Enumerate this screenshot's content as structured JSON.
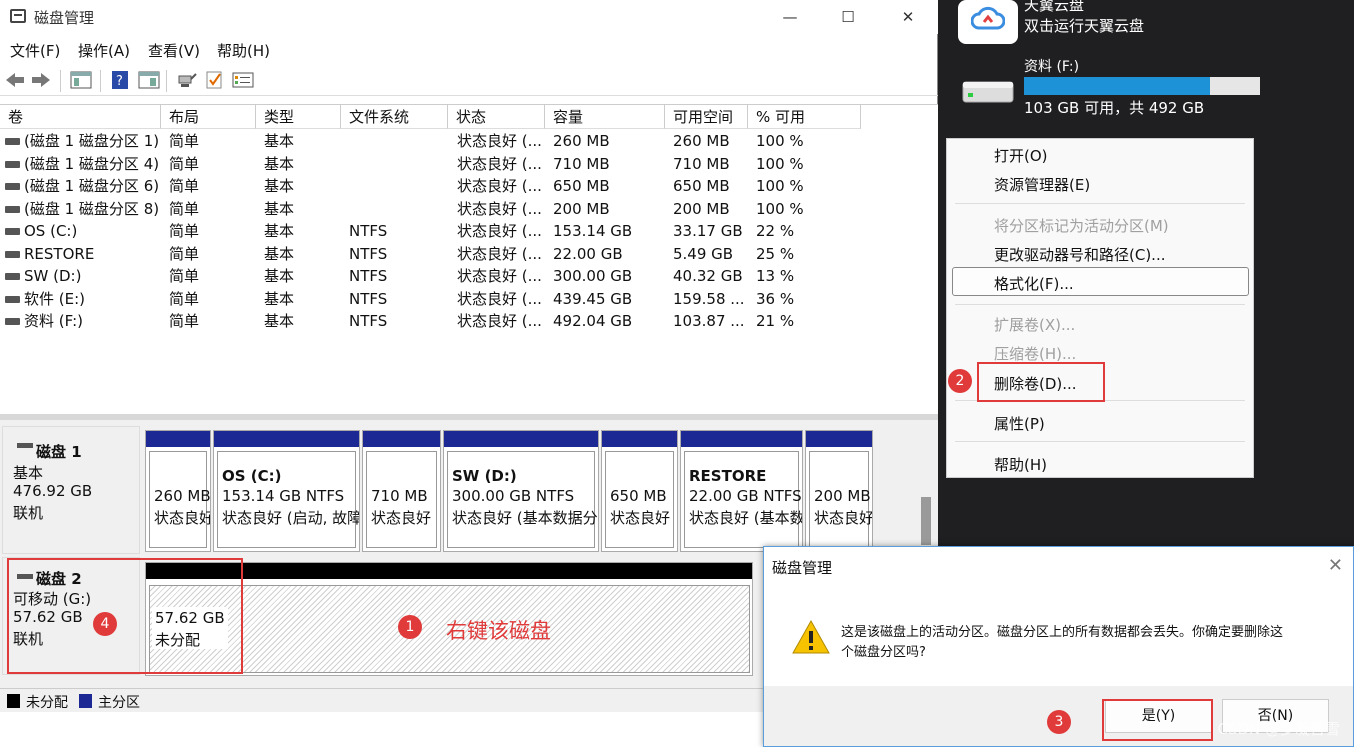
{
  "window": {
    "title": "磁盘管理",
    "controls": {
      "minimize": "—",
      "maximize": "☐",
      "close": "✕"
    }
  },
  "menubar": [
    {
      "label": "文件(F)"
    },
    {
      "label": "操作(A)"
    },
    {
      "label": "查看(V)"
    },
    {
      "label": "帮助(H)"
    }
  ],
  "table": {
    "headers": [
      "卷",
      "布局",
      "类型",
      "文件系统",
      "状态",
      "容量",
      "可用空间",
      "% 可用"
    ],
    "rows": [
      [
        "(磁盘 1 磁盘分区 1)",
        "简单",
        "基本",
        "",
        "状态良好 (...",
        "260 MB",
        "260 MB",
        "100 %"
      ],
      [
        "(磁盘 1 磁盘分区 4)",
        "简单",
        "基本",
        "",
        "状态良好 (...",
        "710 MB",
        "710 MB",
        "100 %"
      ],
      [
        "(磁盘 1 磁盘分区 6)",
        "简单",
        "基本",
        "",
        "状态良好 (...",
        "650 MB",
        "650 MB",
        "100 %"
      ],
      [
        "(磁盘 1 磁盘分区 8)",
        "简单",
        "基本",
        "",
        "状态良好 (...",
        "200 MB",
        "200 MB",
        "100 %"
      ],
      [
        "OS (C:)",
        "简单",
        "基本",
        "NTFS",
        "状态良好 (...",
        "153.14 GB",
        "33.17 GB",
        "22 %"
      ],
      [
        "RESTORE",
        "简单",
        "基本",
        "NTFS",
        "状态良好 (...",
        "22.00 GB",
        "5.49 GB",
        "25 %"
      ],
      [
        "SW (D:)",
        "简单",
        "基本",
        "NTFS",
        "状态良好 (...",
        "300.00 GB",
        "40.32 GB",
        "13 %"
      ],
      [
        "软件 (E:)",
        "简单",
        "基本",
        "NTFS",
        "状态良好 (...",
        "439.45 GB",
        "159.58 ...",
        "36 %"
      ],
      [
        "资料 (F:)",
        "简单",
        "基本",
        "NTFS",
        "状态良好 (...",
        "492.04 GB",
        "103.87 ...",
        "21 %"
      ]
    ]
  },
  "disk1": {
    "name": "磁盘 1",
    "type": "基本",
    "size": "476.92 GB",
    "status": "联机",
    "partitions": [
      {
        "name": "",
        "size": "260 MB",
        "status": "状态良好"
      },
      {
        "name": "OS  (C:)",
        "size": "153.14 GB NTFS",
        "status": "状态良好 (启动, 故障"
      },
      {
        "name": "",
        "size": "710 MB",
        "status": "状态良好"
      },
      {
        "name": "SW  (D:)",
        "size": "300.00 GB NTFS",
        "status": "状态良好 (基本数据分"
      },
      {
        "name": "",
        "size": "650 MB",
        "status": "状态良好"
      },
      {
        "name": "RESTORE",
        "size": "22.00 GB NTFS",
        "status": "状态良好 (基本数"
      },
      {
        "name": "",
        "size": "200 MB",
        "status": "状态良好"
      }
    ]
  },
  "disk2": {
    "name": "磁盘 2",
    "type": "可移动 (G:)",
    "size": "57.62 GB",
    "status": "联机",
    "partition": {
      "size": "57.62 GB",
      "status": "未分配"
    }
  },
  "legend": [
    {
      "label": "未分配",
      "color": "#000000"
    },
    {
      "label": "主分区",
      "color": "#1c2893"
    }
  ],
  "annotations": {
    "step1": "1",
    "step1_text": "右键该磁盘",
    "step2": "2",
    "step3": "3",
    "step4": "4",
    "color": "#e03a3a"
  },
  "explorer": {
    "cloud_app_title": "天翼云盘",
    "cloud_app_subtitle": "双击运行天翼云盘",
    "drive_name": "资料 (F:)",
    "drive_free": "103 GB 可用，共 492 GB",
    "drive_used_fraction": 0.79
  },
  "context_menu": {
    "items": [
      {
        "label": "打开(O)",
        "enabled": true
      },
      {
        "label": "资源管理器(E)",
        "enabled": true
      },
      {
        "label": "将分区标记为活动分区(M)",
        "enabled": false
      },
      {
        "label": "更改驱动器号和路径(C)...",
        "enabled": true
      },
      {
        "label": "格式化(F)...",
        "enabled": true
      },
      {
        "label": "扩展卷(X)...",
        "enabled": false
      },
      {
        "label": "压缩卷(H)...",
        "enabled": false
      },
      {
        "label": "删除卷(D)...",
        "enabled": true
      },
      {
        "label": "属性(P)",
        "enabled": true
      },
      {
        "label": "帮助(H)",
        "enabled": true
      }
    ]
  },
  "dialog": {
    "title": "磁盘管理",
    "message_line1": "这是该磁盘上的活动分区。磁盘分区上的所有数据都会丢失。你确定要删除这",
    "message_line2": "个磁盘分区吗?",
    "yes": "是(Y)",
    "no": "否(N)"
  },
  "watermark": "CSDN @梦凝哲雪"
}
